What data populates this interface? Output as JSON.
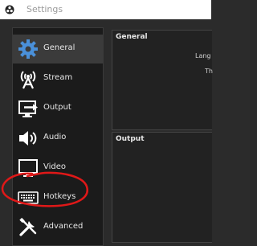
{
  "titlebar": {
    "title": "Settings",
    "app_icon": "obs-icon"
  },
  "sidebar": {
    "items": [
      {
        "label": "General",
        "icon": "gear-icon",
        "active": true
      },
      {
        "label": "Stream",
        "icon": "antenna-icon"
      },
      {
        "label": "Output",
        "icon": "output-icon"
      },
      {
        "label": "Audio",
        "icon": "speaker-icon"
      },
      {
        "label": "Video",
        "icon": "monitor-icon"
      },
      {
        "label": "Hotkeys",
        "icon": "keyboard-icon"
      },
      {
        "label": "Advanced",
        "icon": "wrench-screwdriver-icon"
      }
    ]
  },
  "main": {
    "general_section": {
      "title": "General",
      "lines": [
        "Lang",
        "Th"
      ]
    },
    "output_section": {
      "title": "Output"
    }
  },
  "annotation": {
    "type": "red hand-drawn circle",
    "target": "Hotkeys",
    "color": "#e01818"
  }
}
